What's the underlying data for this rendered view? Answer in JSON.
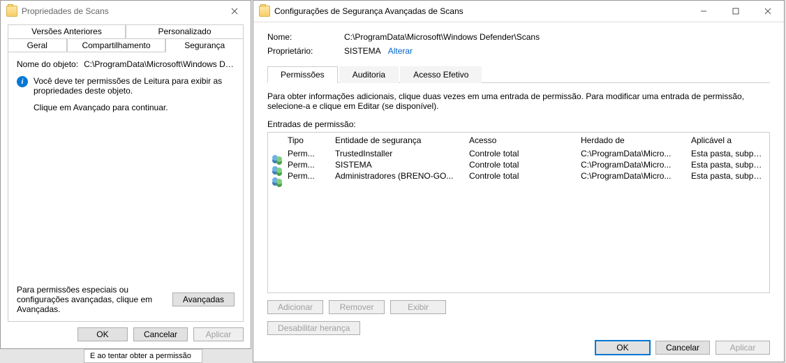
{
  "small": {
    "title": "Propriedades de Scans",
    "tabs_r1": [
      "Versões Anteriores",
      "Personalizado"
    ],
    "tabs_r2": [
      "Geral",
      "Compartilhamento",
      "Segurança"
    ],
    "active_tab": "Segurança",
    "nome_label": "Nome do objeto:",
    "nome_value": "C:\\ProgramData\\Microsoft\\Windows Defender",
    "info_line1": "Você deve ter permissões de Leitura para exibir as propriedades deste objeto.",
    "info_line2": "Clique em Avançado para continuar.",
    "adv_label": "Para permissões especiais ou configurações avançadas, clique em Avançadas.",
    "btn_adv": "Avançadas",
    "btn_ok": "OK",
    "btn_cancel": "Cancelar",
    "btn_apply": "Aplicar"
  },
  "big": {
    "title": "Configurações de Segurança Avançadas de Scans",
    "nome_label": "Nome:",
    "nome_value": "C:\\ProgramData\\Microsoft\\Windows Defender\\Scans",
    "owner_label": "Proprietário:",
    "owner_value": "SISTEMA",
    "owner_change": "Alterar",
    "tabs": [
      "Permissões",
      "Auditoria",
      "Acesso Efetivo"
    ],
    "active_tab": "Permissões",
    "note": "Para obter informações adicionais, clique duas vezes em uma entrada de permissão. Para modificar uma entrada de permissão, selecione-a e clique em Editar (se disponível).",
    "list_label": "Entradas de permissão:",
    "cols": {
      "tipo": "Tipo",
      "entidade": "Entidade de segurança",
      "acesso": "Acesso",
      "herdado": "Herdado de",
      "aplicavel": "Aplicável a"
    },
    "rows": [
      {
        "tipo": "Perm...",
        "entidade": "TrustedInstaller",
        "acesso": "Controle total",
        "herdado": "C:\\ProgramData\\Micro...",
        "aplicavel": "Esta pasta, subpastas e arquivos"
      },
      {
        "tipo": "Perm...",
        "entidade": "SISTEMA",
        "acesso": "Controle total",
        "herdado": "C:\\ProgramData\\Micro...",
        "aplicavel": "Esta pasta, subpastas e arquivos"
      },
      {
        "tipo": "Perm...",
        "entidade": "Administradores (BRENO-GO...",
        "acesso": "Controle total",
        "herdado": "C:\\ProgramData\\Micro...",
        "aplicavel": "Esta pasta, subpastas e arquivos"
      }
    ],
    "btn_add": "Adicionar",
    "btn_remove": "Remover",
    "btn_view": "Exibir",
    "btn_disable": "Desabilitar herança",
    "btn_ok": "OK",
    "btn_cancel": "Cancelar",
    "btn_apply": "Aplicar"
  },
  "snip": "E ao tentar obter a permissão"
}
